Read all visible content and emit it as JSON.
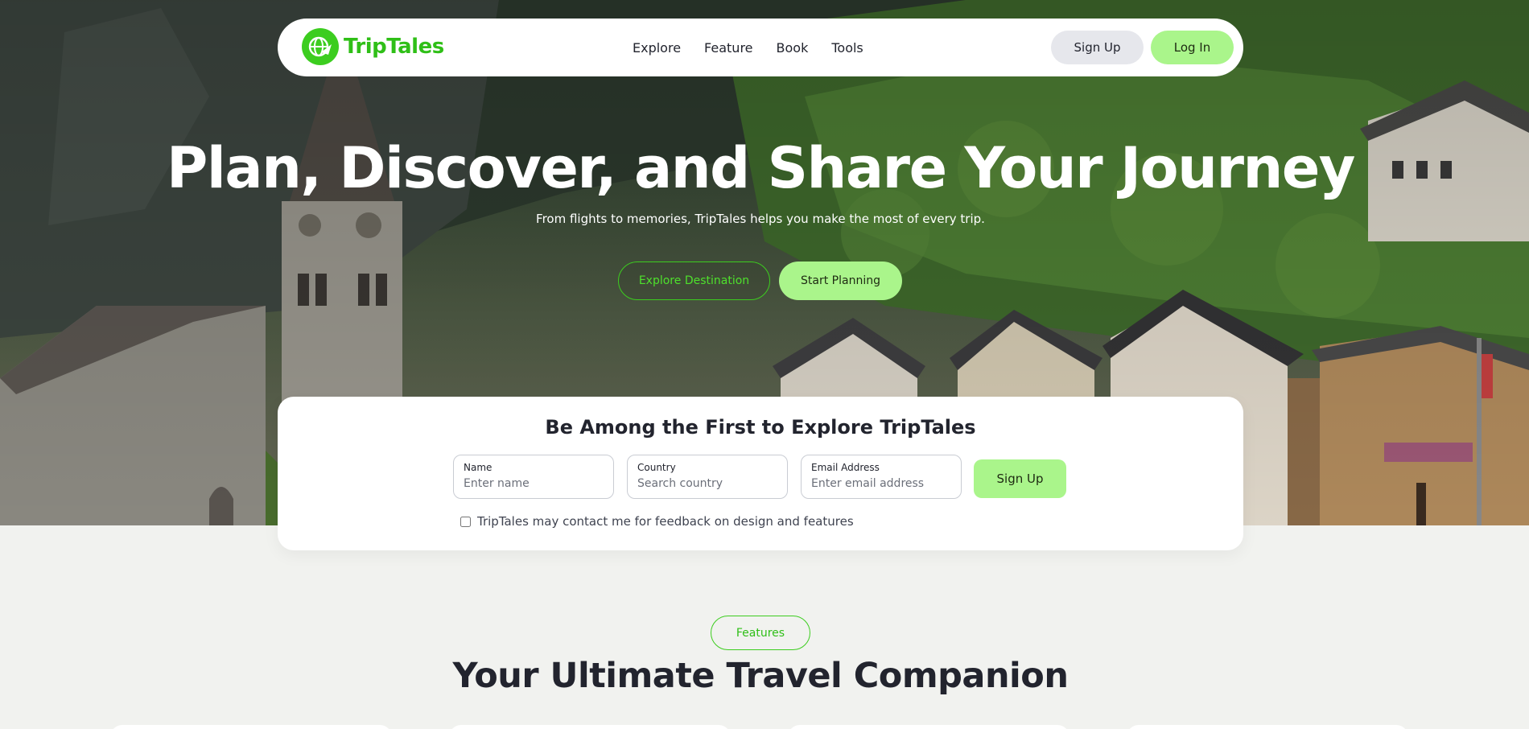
{
  "brand": {
    "name": "TripTales",
    "accent": "#3ccd1f",
    "accent_light": "#aaf58b"
  },
  "nav": {
    "links": [
      "Explore",
      "Feature",
      "Book",
      "Tools"
    ],
    "signup_label": "Sign Up",
    "login_label": "Log In"
  },
  "hero": {
    "title": "Plan, Discover, and Share Your Journey",
    "subtitle": "From flights to memories, TripTales helps you make the most of every trip.",
    "explore_label": "Explore Destination",
    "start_label": "Start Planning"
  },
  "signup": {
    "title": "Be Among the First to Explore TripTales",
    "name_label": "Name",
    "name_placeholder": "Enter name",
    "country_label": "Country",
    "country_placeholder": "Search country",
    "email_label": "Email Address",
    "email_placeholder": "Enter email address",
    "submit_label": "Sign Up",
    "consent_text": "TripTales may contact me for feedback on design and features"
  },
  "features": {
    "pill_label": "Features",
    "title": "Your Ultimate Travel Companion"
  }
}
